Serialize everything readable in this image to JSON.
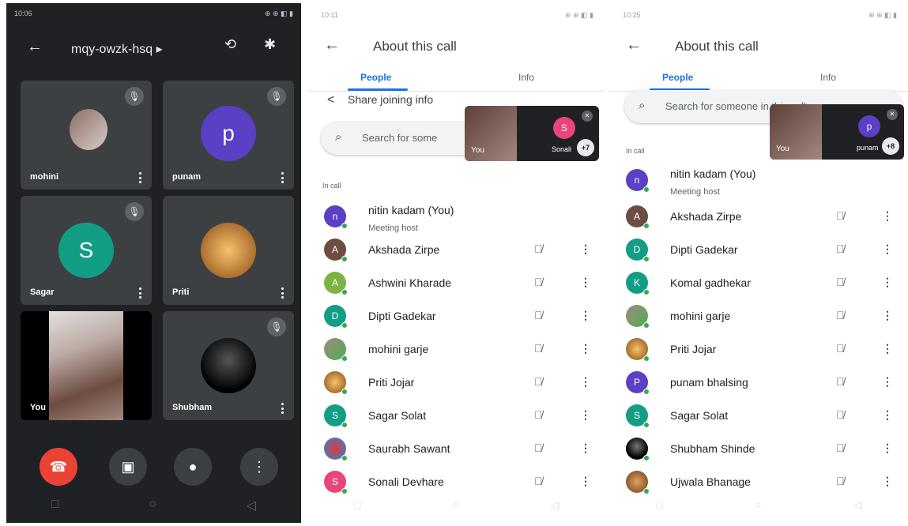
{
  "panel1": {
    "status_time": "10:06",
    "status_icons": "⊕ ⊕ ◧ ▮",
    "meeting_code": "mqy-owzk-hsq ▸",
    "tiles": [
      {
        "name": "mohini",
        "kind": "photo"
      },
      {
        "name": "punam",
        "kind": "letter",
        "letter": "p",
        "color": "#5b3fc4"
      },
      {
        "name": "Sagar",
        "kind": "letter",
        "letter": "S",
        "color": "#129e85"
      },
      {
        "name": "Priti",
        "kind": "photo"
      },
      {
        "name": "You",
        "kind": "video"
      },
      {
        "name": "Shubham",
        "kind": "photo"
      }
    ]
  },
  "panel2": {
    "status_time": "10:11",
    "status_icons": "⊕ ⊕ ◧ ▮",
    "title": "About this call",
    "tab_people": "People",
    "tab_info": "Info",
    "share_label": "Share joining info",
    "search_placeholder": "Search for some",
    "in_call_label": "In call",
    "pip": {
      "you": "You",
      "name": "Sonali",
      "letter": "S",
      "color": "#e8457a",
      "badge": "+7"
    },
    "host": {
      "name": "nitin kadam (You)",
      "sub": "Meeting host",
      "letter": "n",
      "color": "#5b3fc4"
    },
    "participants": [
      {
        "name": "Akshada Zirpe",
        "letter": "A",
        "color": "#6d4c41"
      },
      {
        "name": "Ashwini Kharade",
        "letter": "A",
        "color": "#7cb342"
      },
      {
        "name": "Dipti Gadekar",
        "letter": "D",
        "color": "#129e85"
      },
      {
        "name": "mohini garje",
        "letter": "",
        "color": "#a1887f"
      },
      {
        "name": "Priti Jojar",
        "letter": "",
        "color": "#c77a34"
      },
      {
        "name": "Sagar Solat",
        "letter": "S",
        "color": "#129e85"
      },
      {
        "name": "Saurabh Sawant",
        "letter": "",
        "color": "#3b82c4"
      },
      {
        "name": "Sonali Devhare",
        "letter": "S",
        "color": "#e8457a"
      }
    ]
  },
  "panel3": {
    "status_time": "10:25",
    "status_icons": "⊕ ⊕ ◧ ▮",
    "title": "About this call",
    "tab_people": "People",
    "tab_info": "Info",
    "search_placeholder": "Search for someone in this call",
    "in_call_label": "In call",
    "pip": {
      "you": "You",
      "name": "punam",
      "letter": "p",
      "color": "#5b3fc4",
      "badge": "+8"
    },
    "host": {
      "name": "nitin kadam (You)",
      "sub": "Meeting host",
      "letter": "n",
      "color": "#5b3fc4"
    },
    "participants": [
      {
        "name": "Akshada Zirpe",
        "letter": "A",
        "color": "#6d4c41"
      },
      {
        "name": "Dipti Gadekar",
        "letter": "D",
        "color": "#129e85"
      },
      {
        "name": "Komal gadhekar",
        "letter": "K",
        "color": "#129e85"
      },
      {
        "name": "mohini garje",
        "letter": "",
        "color": "#a1887f"
      },
      {
        "name": "Priti Jojar",
        "letter": "",
        "color": "#c77a34"
      },
      {
        "name": "punam bhalsing",
        "letter": "P",
        "color": "#5b3fc4"
      },
      {
        "name": "Sagar Solat",
        "letter": "S",
        "color": "#129e85"
      },
      {
        "name": "Shubham Shinde",
        "letter": "",
        "color": "#111111"
      },
      {
        "name": "Ujwala Bhanage",
        "letter": "",
        "color": "#9c6b3a"
      }
    ]
  }
}
